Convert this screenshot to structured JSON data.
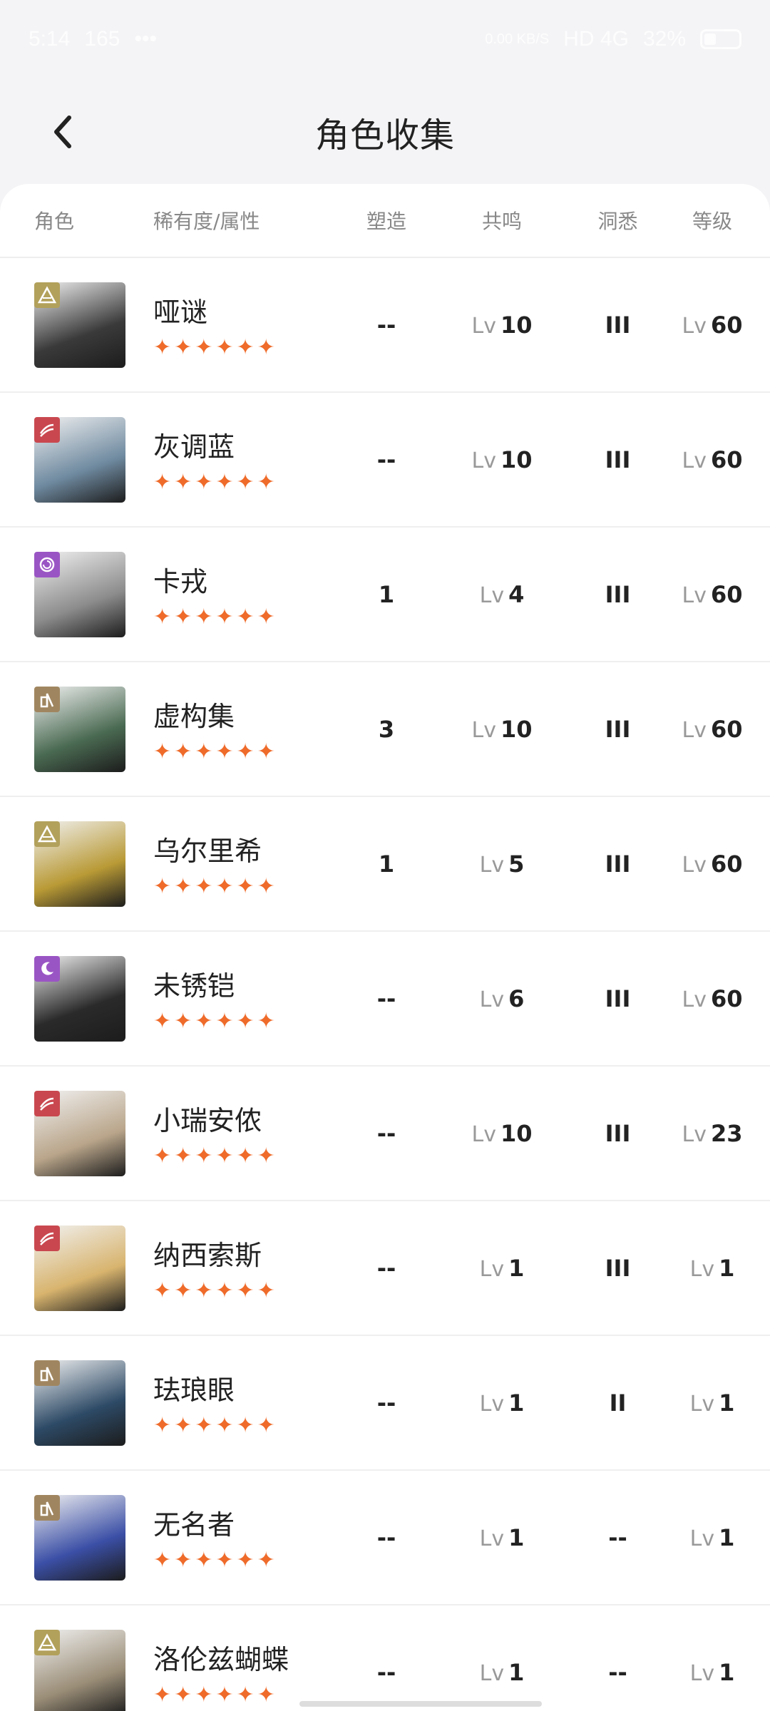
{
  "status": {
    "time": "5:14",
    "speed": "165",
    "net_speed": "0.00 KB/S",
    "signal": "HD 4G",
    "battery": "32%"
  },
  "nav": {
    "title": "角色收集"
  },
  "header": {
    "role": "角色",
    "rarity": "稀有度/属性",
    "shape": "塑造",
    "resonance": "共鸣",
    "insight": "洞悉",
    "level": "等级"
  },
  "lv_prefix": "Lv",
  "rows": [
    {
      "name": "哑谜",
      "stars": "✦✦✦✦✦✦",
      "shape": "--",
      "res": "10",
      "insight": "III",
      "level": "60",
      "badge": "mountain-icon",
      "badge_color": "#b2a15b",
      "tone": "#3a3a3a"
    },
    {
      "name": "灰调蓝",
      "stars": "✦✦✦✦✦✦",
      "shape": "--",
      "res": "10",
      "insight": "III",
      "level": "60",
      "badge": "wind-icon",
      "badge_color": "#c9484f",
      "tone": "#6f8aa0"
    },
    {
      "name": "卡戎",
      "stars": "✦✦✦✦✦✦",
      "shape": "1",
      "res": "4",
      "insight": "III",
      "level": "60",
      "badge": "spiral-icon",
      "badge_color": "#9a55c4",
      "tone": "#8c8c8c"
    },
    {
      "name": "虚构集",
      "stars": "✦✦✦✦✦✦",
      "shape": "3",
      "res": "10",
      "insight": "III",
      "level": "60",
      "badge": "tower-icon",
      "badge_color": "#a08660",
      "tone": "#4a6a52"
    },
    {
      "name": "乌尔里希",
      "stars": "✦✦✦✦✦✦",
      "shape": "1",
      "res": "5",
      "insight": "III",
      "level": "60",
      "badge": "mountain-icon",
      "badge_color": "#b2a15b",
      "tone": "#b99a36"
    },
    {
      "name": "未锈铠",
      "stars": "✦✦✦✦✦✦",
      "shape": "--",
      "res": "6",
      "insight": "III",
      "level": "60",
      "badge": "moon-icon",
      "badge_color": "#9a55c4",
      "tone": "#2a2a2a"
    },
    {
      "name": "小瑞安侬",
      "stars": "✦✦✦✦✦✦",
      "shape": "--",
      "res": "10",
      "insight": "III",
      "level": "23",
      "badge": "wind-icon",
      "badge_color": "#c9484f",
      "tone": "#b9a58a"
    },
    {
      "name": "纳西索斯",
      "stars": "✦✦✦✦✦✦",
      "shape": "--",
      "res": "1",
      "insight": "III",
      "level": "1",
      "badge": "wind-icon",
      "badge_color": "#c9484f",
      "tone": "#d8b46e"
    },
    {
      "name": "珐琅眼",
      "stars": "✦✦✦✦✦✦",
      "shape": "--",
      "res": "1",
      "insight": "II",
      "level": "1",
      "badge": "tower-icon",
      "badge_color": "#a08660",
      "tone": "#2d4a66"
    },
    {
      "name": "无名者",
      "stars": "✦✦✦✦✦✦",
      "shape": "--",
      "res": "1",
      "insight": "--",
      "level": "1",
      "badge": "tower-icon",
      "badge_color": "#a08660",
      "tone": "#3b4fa6"
    },
    {
      "name": "洛伦兹蝴蝶",
      "stars": "✦✦✦✦✦✦",
      "shape": "--",
      "res": "1",
      "insight": "--",
      "level": "1",
      "badge": "mountain-icon",
      "badge_color": "#b2a15b",
      "tone": "#9b8e78"
    }
  ]
}
